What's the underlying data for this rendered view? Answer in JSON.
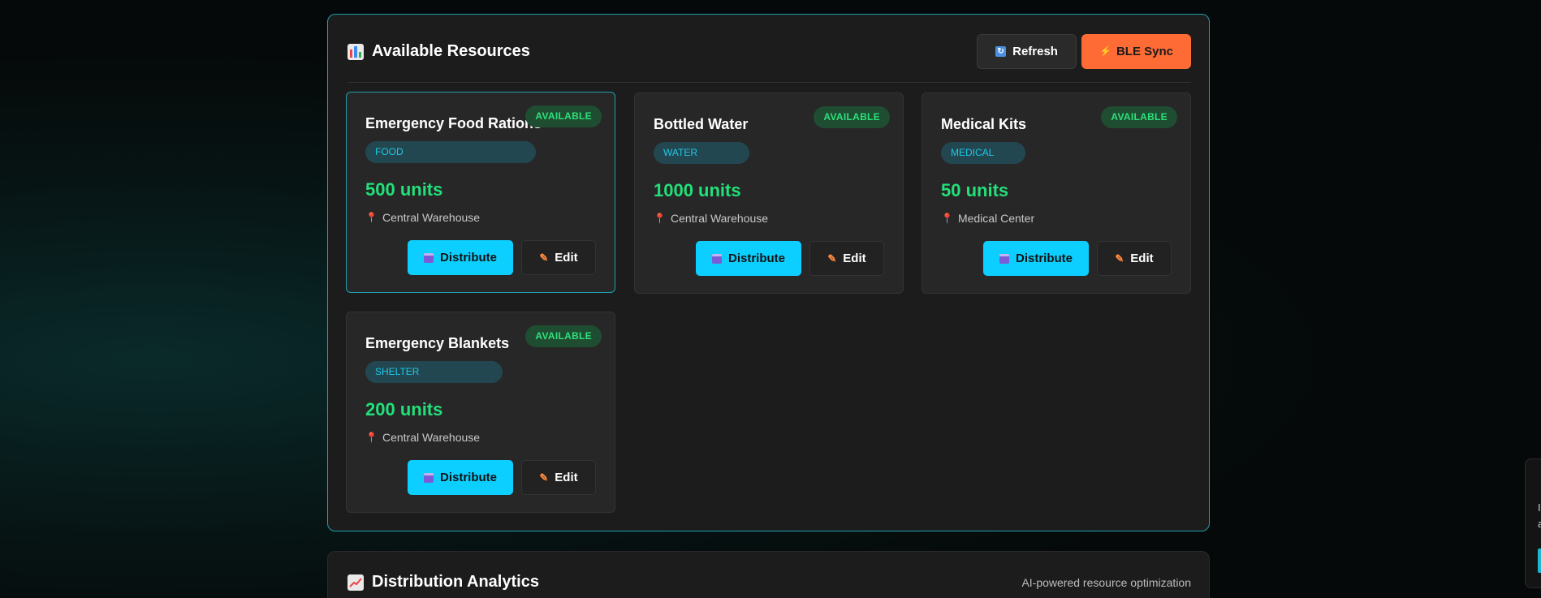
{
  "resources_panel": {
    "title": "Available Resources",
    "refresh_label": "Refresh",
    "ble_sync_label": "BLE Sync"
  },
  "resources": [
    {
      "name": "Emergency Food Rations",
      "status": "AVAILABLE",
      "category": "FOOD",
      "quantity": "500 units",
      "location": "Central Warehouse",
      "distribute_label": "Distribute",
      "edit_label": "Edit"
    },
    {
      "name": "Bottled Water",
      "status": "AVAILABLE",
      "category": "WATER",
      "quantity": "1000 units",
      "location": "Central Warehouse",
      "distribute_label": "Distribute",
      "edit_label": "Edit"
    },
    {
      "name": "Medical Kits",
      "status": "AVAILABLE",
      "category": "MEDICAL",
      "quantity": "50 units",
      "location": "Medical Center",
      "distribute_label": "Distribute",
      "edit_label": "Edit"
    },
    {
      "name": "Emergency Blankets",
      "status": "AVAILABLE",
      "category": "SHELTER",
      "quantity": "200 units",
      "location": "Central Warehouse",
      "distribute_label": "Distribute",
      "edit_label": "Edit"
    }
  ],
  "analytics_panel": {
    "title": "Distribution Analytics",
    "subtitle": "AI-powered resource optimization"
  },
  "side_widget": {
    "line1": "I",
    "line2": "a"
  },
  "colors": {
    "accent_cyan": "#0dcfff",
    "accent_orange": "#ff6b35",
    "available_green": "#22e07a",
    "panel_border": "#1f9fad"
  },
  "icons": {
    "resources_title": "bar-chart-icon",
    "analytics_title": "line-chart-icon",
    "refresh": "refresh-icon",
    "ble_sync": "satellite-icon",
    "distribute": "package-icon",
    "edit": "pencil-icon",
    "location": "pin-icon"
  }
}
